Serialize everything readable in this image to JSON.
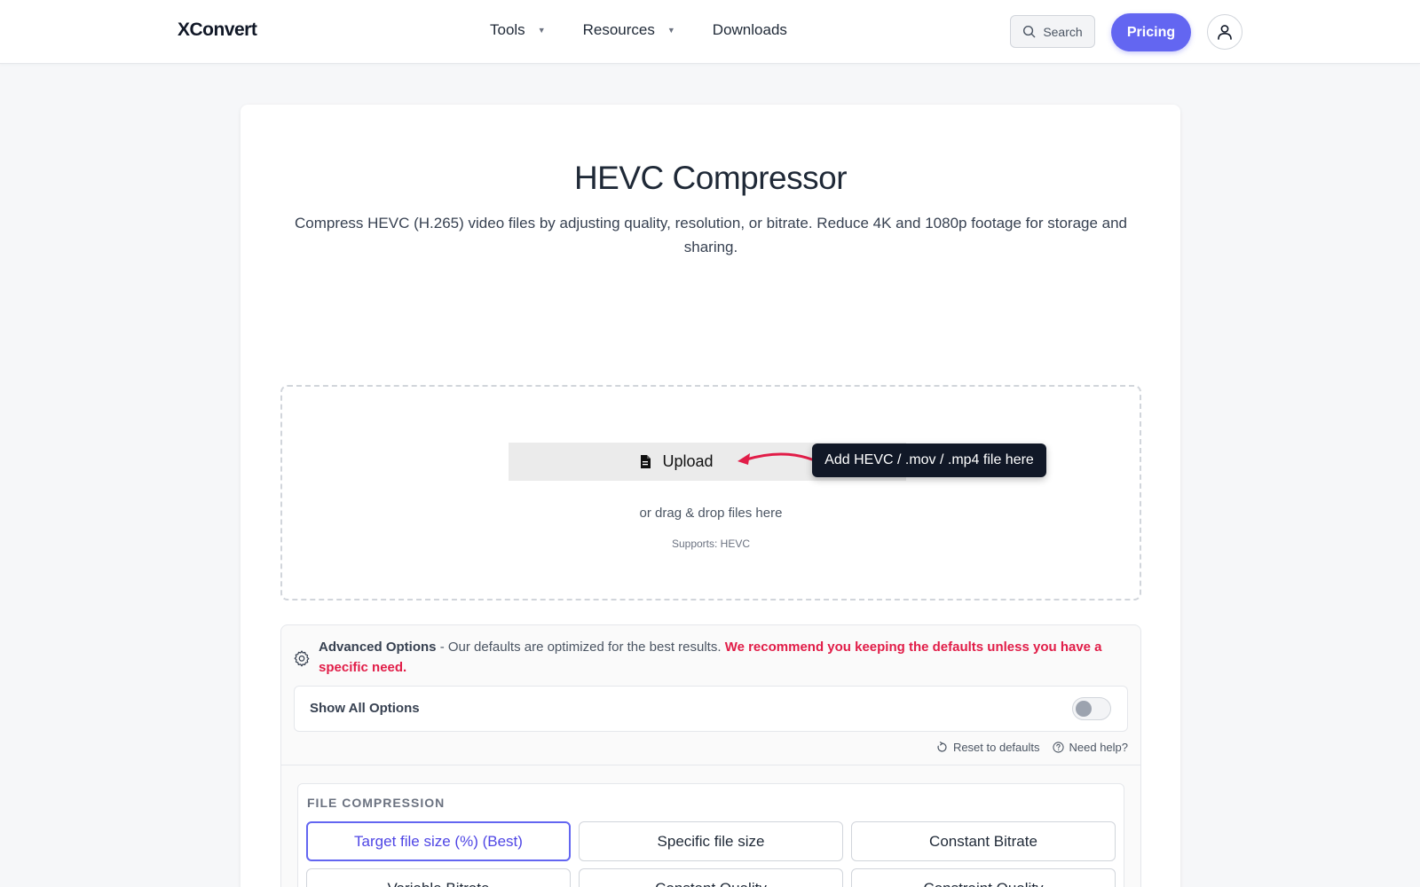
{
  "header": {
    "logo": "XConvert",
    "nav": [
      {
        "label": "Tools",
        "has_dropdown": true
      },
      {
        "label": "Resources",
        "has_dropdown": true
      },
      {
        "label": "Downloads",
        "has_dropdown": false
      }
    ],
    "search_label": "Search",
    "pricing_label": "Pricing",
    "icons": {
      "search": "search-icon",
      "avatar": "user-icon",
      "caret": "caret-down-icon"
    }
  },
  "main": {
    "title": "HEVC Compressor",
    "subtitle": "Compress HEVC (H.265) video files by adjusting quality, resolution, or bitrate. Reduce 4K and 1080p footage for storage and sharing."
  },
  "dropzone": {
    "upload_label": "Upload",
    "tooltip": "Add HEVC / .mov / .mp4 file here",
    "drag_text": "or drag & drop files here",
    "supports": "Supports: HEVC"
  },
  "advanced": {
    "title": "Advanced Options",
    "description": " - Our defaults are optimized for the best results. ",
    "warning": "We recommend you keeping the defaults unless you have a specific need.",
    "show_all_label": "Show All Options",
    "show_all_enabled": false,
    "reset_label": "Reset to defaults",
    "help_label": "Need help?"
  },
  "compression": {
    "section_title": "FILE COMPRESSION",
    "options": [
      {
        "label": "Target file size (%) (Best)",
        "selected": true
      },
      {
        "label": "Specific file size",
        "selected": false
      },
      {
        "label": "Constant Bitrate",
        "selected": false
      },
      {
        "label": "Variable Bitrate",
        "selected": false
      },
      {
        "label": "Constant Quality",
        "selected": false
      },
      {
        "label": "Constraint Quality",
        "selected": false
      }
    ]
  },
  "colors": {
    "accent": "#6366f1",
    "warning": "#e11d48",
    "tooltip_bg": "#111827",
    "arrow": "#e11d48"
  }
}
